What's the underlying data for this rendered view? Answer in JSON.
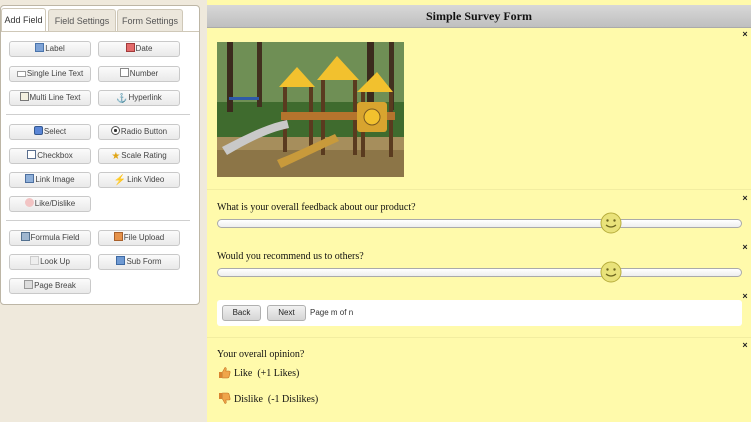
{
  "tabs": [
    "Add Field",
    "Field Settings",
    "Form Settings"
  ],
  "field_buttons": {
    "label": "Label",
    "date": "Date",
    "single_line_text": "Single Line Text",
    "number": "Number",
    "multi_line_text": "Multi Line Text",
    "hyperlink": "Hyperlink",
    "select": "Select",
    "radio_button": "Radio Button",
    "checkbox": "Checkbox",
    "scale_rating": "Scale Rating",
    "link_image": "Link Image",
    "link_video": "Link Video",
    "like_dislike": "Like/Dislike",
    "formula_field": "Formula Field",
    "file_upload": "File Upload",
    "look_up": "Look Up",
    "sub_form": "Sub Form",
    "page_break": "Page Break"
  },
  "form": {
    "title": "Simple Survey Form",
    "close_glyph": "×",
    "questions": [
      {
        "text": "What is your overall feedback about our product?",
        "slider_value": 0.75
      },
      {
        "text": "Would you recommend us to others?",
        "slider_value": 0.75
      }
    ],
    "pager": {
      "back": "Back",
      "next": "Next",
      "page_info": "Page m of n"
    },
    "opinion": {
      "title": "Your overall opinion?",
      "like_label": "Like",
      "like_count": "(+1 Likes)",
      "dislike_label": "Dislike",
      "dislike_count": "(-1 Dislikes)"
    }
  },
  "icons": {
    "smiley": "smiley-slider-handle-icon",
    "like": "thumbs-up-icon",
    "dislike": "thumbs-down-icon"
  },
  "colors": {
    "form_background": "#fffaab",
    "header_background": "#c8c8c8",
    "panel_background": "#efe9dc"
  }
}
